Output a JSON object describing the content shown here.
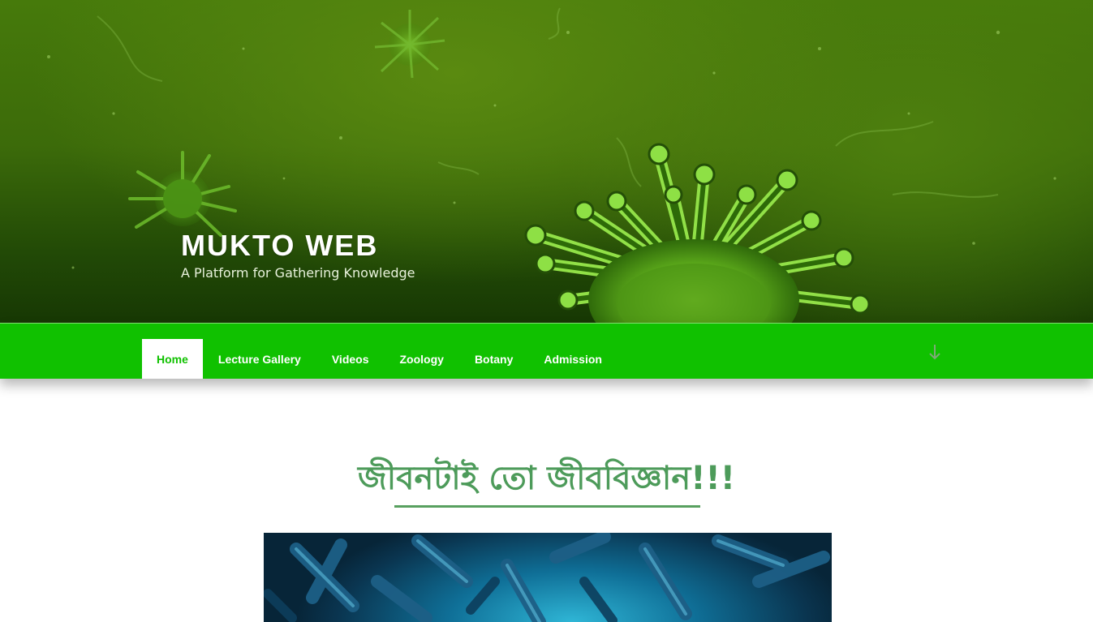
{
  "site": {
    "title": "MUKTO WEB",
    "tagline": "A Platform for Gathering Knowledge"
  },
  "nav": {
    "items": [
      {
        "label": "Home",
        "active": true
      },
      {
        "label": "Lecture Gallery",
        "active": false
      },
      {
        "label": "Videos",
        "active": false
      },
      {
        "label": "Zoology",
        "active": false
      },
      {
        "label": "Botany",
        "active": false
      },
      {
        "label": "Admission",
        "active": false
      }
    ],
    "scroll_icon": "arrow-down-icon"
  },
  "content": {
    "heading": "জীবনটাই তো জীববিজ্ঞান!!!"
  },
  "colors": {
    "nav_bg": "#10c100",
    "heading": "#4d9b5a",
    "hero_bg": "#3c6b0a",
    "feature_bg": "#0f6f97"
  }
}
